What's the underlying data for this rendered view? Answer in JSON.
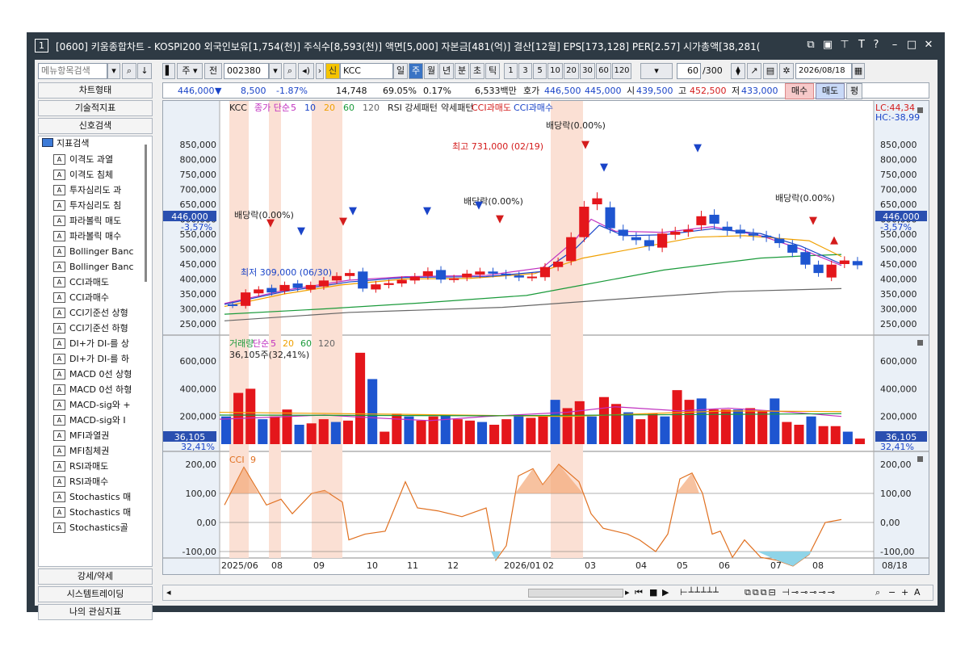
{
  "title": {
    "num": "1",
    "text": "[0600] 키움종합차트 - KOSPI200 외국인보유[1,754(천)] 주식수[8,593(천)] 액면[5,000] 자본금[481(억)] 결산[12월] EPS[173,128] PER[2.57] 시가총액[38,281("
  },
  "toolbar": {
    "period": "주",
    "prev": "전",
    "code": "002380",
    "shin": "신",
    "name": "KCC",
    "periods": [
      "일",
      "주",
      "월",
      "년",
      "분",
      "초",
      "틱"
    ],
    "nums": [
      "1",
      "3",
      "5",
      "10",
      "20",
      "30",
      "60",
      "120"
    ],
    "count": "60",
    "count_total": "/300",
    "date": "2026/08/18"
  },
  "left": {
    "search_placeholder": "메뉴항목검색",
    "chart_type": "차트형태",
    "tech": "기술적지표",
    "signal": "신호검색",
    "tree_root": "지표검색",
    "items": [
      "이격도 과열",
      "이격도 침체",
      "투자심리도 과",
      "투자심리도 침",
      "파라볼릭 매도",
      "파라볼릭 매수",
      "Bollinger Banc",
      "Bollinger Banc",
      "CCI과매도",
      "CCI과매수",
      "CCI기준선 상형",
      "CCI기준선 하형",
      "DI+가 DI-를 상",
      "DI+가 DI-를 하",
      "MACD 0선 상형",
      "MACD 0선 하형",
      "MACD-sig와 +",
      "MACD-sig와 I",
      "MFI과열권",
      "MFI침체권",
      "RSI과매도",
      "RSI과매수",
      "Stochastics 매",
      "Stochastics 매",
      "Stochastics골"
    ],
    "strong": "강세/약세",
    "trade": "시스템트레이딩",
    "fav": "나의 관심지표"
  },
  "quote": {
    "price": "446,000",
    "arrow": "▼",
    "chg": "8,500",
    "pct": "-1.87%",
    "vol": "14,748",
    "r1": "69.05%",
    "r2": "0.17%",
    "amt": "6,533백만",
    "hoga_l": "호가",
    "hoga1": "446,500",
    "hoga2": "445,000",
    "s_l": "시",
    "s": "439,500",
    "g_l": "고",
    "g": "452,500",
    "j_l": "저",
    "j": "433,000",
    "buy": "매수",
    "sell": "매도",
    "p": "평"
  },
  "legend": {
    "main": [
      "KCC",
      "종가 단순",
      "5",
      "10",
      "20",
      "60",
      "120",
      "RSI 강세패턴",
      "약세패턴",
      "CCI과매도",
      "CCI과매수"
    ],
    "vol": [
      "거래량",
      "단순",
      "5",
      "20",
      "60",
      "120"
    ],
    "vol_val": "36,105주(32,41%)",
    "cci": "CCI",
    "cci_p": "9",
    "lc": "LC:44,34",
    "hc": "HC:-38,99"
  },
  "annotations": {
    "div": "배당락(0.00%)",
    "high": "최고 731,000 (02/19)",
    "low": "최저 309,000 (06/30)",
    "cur": "446,000",
    "cur_pct": "-3,57%",
    "vol_cur": "36,105",
    "vol_pct": "32,41%"
  },
  "axes": {
    "price": [
      "850,000",
      "800,000",
      "750,000",
      "700,000",
      "650,000",
      "600,000",
      "550,000",
      "500,000",
      "450,000",
      "400,000",
      "350,000",
      "300,000",
      "250,000"
    ],
    "vol": [
      "600,000",
      "400,000",
      "200,000"
    ],
    "cci": [
      "200,00",
      "100,00",
      "0,00",
      "-100,00"
    ],
    "x": [
      "2025/06",
      "08",
      "09",
      "10",
      "11",
      "12",
      "2026/01",
      "02",
      "03",
      "04",
      "05",
      "06",
      "07",
      "08"
    ],
    "x_last": "08/18"
  },
  "chart_data": {
    "type": "candlestick",
    "candles": [
      [
        315000,
        312000
      ],
      [
        310000,
        355000
      ],
      [
        352000,
        365000
      ],
      [
        370000,
        355000
      ],
      [
        360000,
        380000
      ],
      [
        385000,
        370000
      ],
      [
        365000,
        380000
      ],
      [
        375000,
        395000
      ],
      [
        395000,
        410000
      ],
      [
        410000,
        420000
      ],
      [
        425000,
        368000
      ],
      [
        365000,
        382000
      ],
      [
        380000,
        386000
      ],
      [
        385000,
        397000
      ],
      [
        395000,
        408000
      ],
      [
        410000,
        426000
      ],
      [
        430000,
        398000
      ],
      [
        400000,
        402000
      ],
      [
        405000,
        418000
      ],
      [
        415000,
        425000
      ],
      [
        425000,
        418000
      ],
      [
        418000,
        412000
      ],
      [
        412000,
        405000
      ],
      [
        405000,
        408000
      ],
      [
        406000,
        440000
      ],
      [
        440000,
        458000
      ],
      [
        460000,
        540000
      ],
      [
        540000,
        642000
      ],
      [
        650000,
        670000
      ],
      [
        640000,
        570000
      ],
      [
        565000,
        545000
      ],
      [
        540000,
        530000
      ],
      [
        530000,
        510000
      ],
      [
        505000,
        552000
      ],
      [
        548000,
        558000
      ],
      [
        558000,
        565000
      ],
      [
        580000,
        610000
      ],
      [
        615000,
        585000
      ],
      [
        575000,
        562000
      ],
      [
        565000,
        552000
      ],
      [
        552000,
        545000
      ],
      [
        545000,
        540000
      ],
      [
        535000,
        520000
      ],
      [
        515000,
        488000
      ],
      [
        490000,
        448000
      ],
      [
        448000,
        420000
      ],
      [
        405000,
        448000
      ],
      [
        450000,
        462000
      ],
      [
        460000,
        446000
      ]
    ],
    "volume": [
      200,
      370,
      400,
      180,
      200,
      250,
      140,
      150,
      180,
      160,
      170,
      660,
      470,
      90,
      220,
      200,
      170,
      200,
      210,
      180,
      170,
      160,
      140,
      180,
      210,
      190,
      210,
      320,
      260,
      310,
      200,
      340,
      290,
      230,
      180,
      220,
      200,
      390,
      320,
      330,
      250,
      250,
      250,
      260,
      240,
      330,
      160,
      140,
      200,
      130,
      130,
      90,
      40
    ]
  }
}
